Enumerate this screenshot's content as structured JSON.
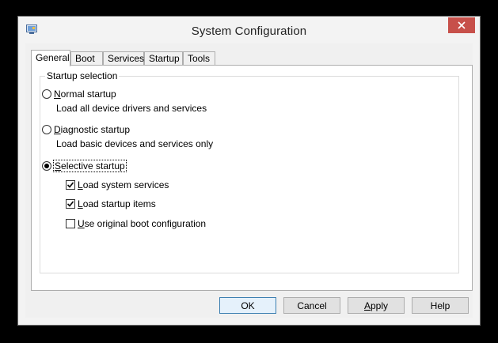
{
  "window": {
    "title": "System Configuration",
    "close_icon": "close-icon"
  },
  "tabs": [
    {
      "label": "General",
      "active": true
    },
    {
      "label": "Boot",
      "active": false
    },
    {
      "label": "Services",
      "active": false
    },
    {
      "label": "Startup",
      "active": false
    },
    {
      "label": "Tools",
      "active": false
    }
  ],
  "startup_selection": {
    "group_label": "Startup selection",
    "normal": {
      "mnemonic": "N",
      "rest": "ormal startup",
      "description": "Load all device drivers and services",
      "selected": false
    },
    "diagnostic": {
      "mnemonic": "D",
      "rest": "iagnostic startup",
      "description": "Load basic devices and services only",
      "selected": false
    },
    "selective": {
      "mnemonic": "S",
      "rest": "elective startup",
      "selected": true
    },
    "options": [
      {
        "mnemonic": "L",
        "rest": "oad system services",
        "checked": true
      },
      {
        "mnemonic": "L",
        "rest": "oad startup items",
        "checked": true
      },
      {
        "mnemonic": "U",
        "rest": "se original boot configuration",
        "checked": false
      }
    ]
  },
  "buttons": {
    "ok": "OK",
    "cancel": "Cancel",
    "apply": {
      "mnemonic": "A",
      "rest": "pply"
    },
    "help": "Help"
  },
  "colors": {
    "close_button": "#c7504a",
    "default_button_border": "#3c7fb1"
  }
}
